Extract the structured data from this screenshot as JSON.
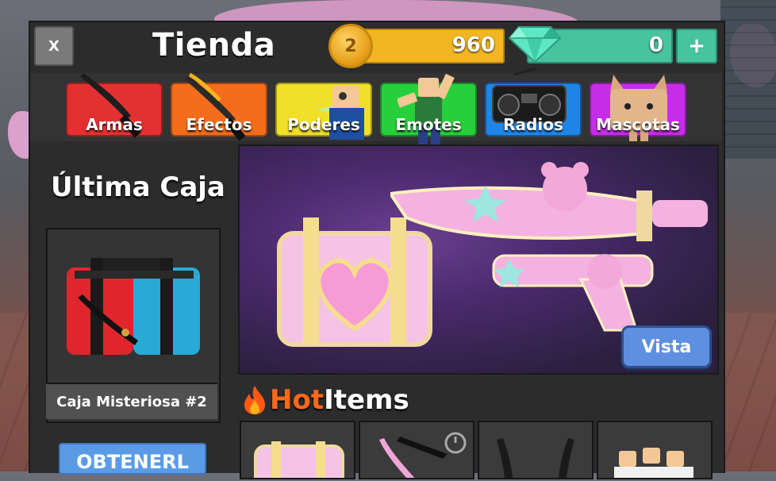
{
  "window": {
    "title": "Tienda",
    "close_label": "X"
  },
  "currency": {
    "coins": "960",
    "coin_symbol": "2",
    "gems": "0",
    "add_label": "+"
  },
  "categories": [
    {
      "label": "Armas",
      "color": "#e33131"
    },
    {
      "label": "Efectos",
      "color": "#f46d1c"
    },
    {
      "label": "Poderes",
      "color": "#f0e02a"
    },
    {
      "label": "Emotes",
      "color": "#27cf3a"
    },
    {
      "label": "Radios",
      "color": "#1f86e8"
    },
    {
      "label": "Mascotas",
      "color": "#c52ee6"
    }
  ],
  "last_box": {
    "heading": "Última Caja",
    "name": "Caja Misteriosa #2",
    "button_label": "OBTENERL"
  },
  "banner": {
    "view_label": "Vista"
  },
  "hot_items": {
    "title_part1": "Hot",
    "title_part2": "Items"
  }
}
